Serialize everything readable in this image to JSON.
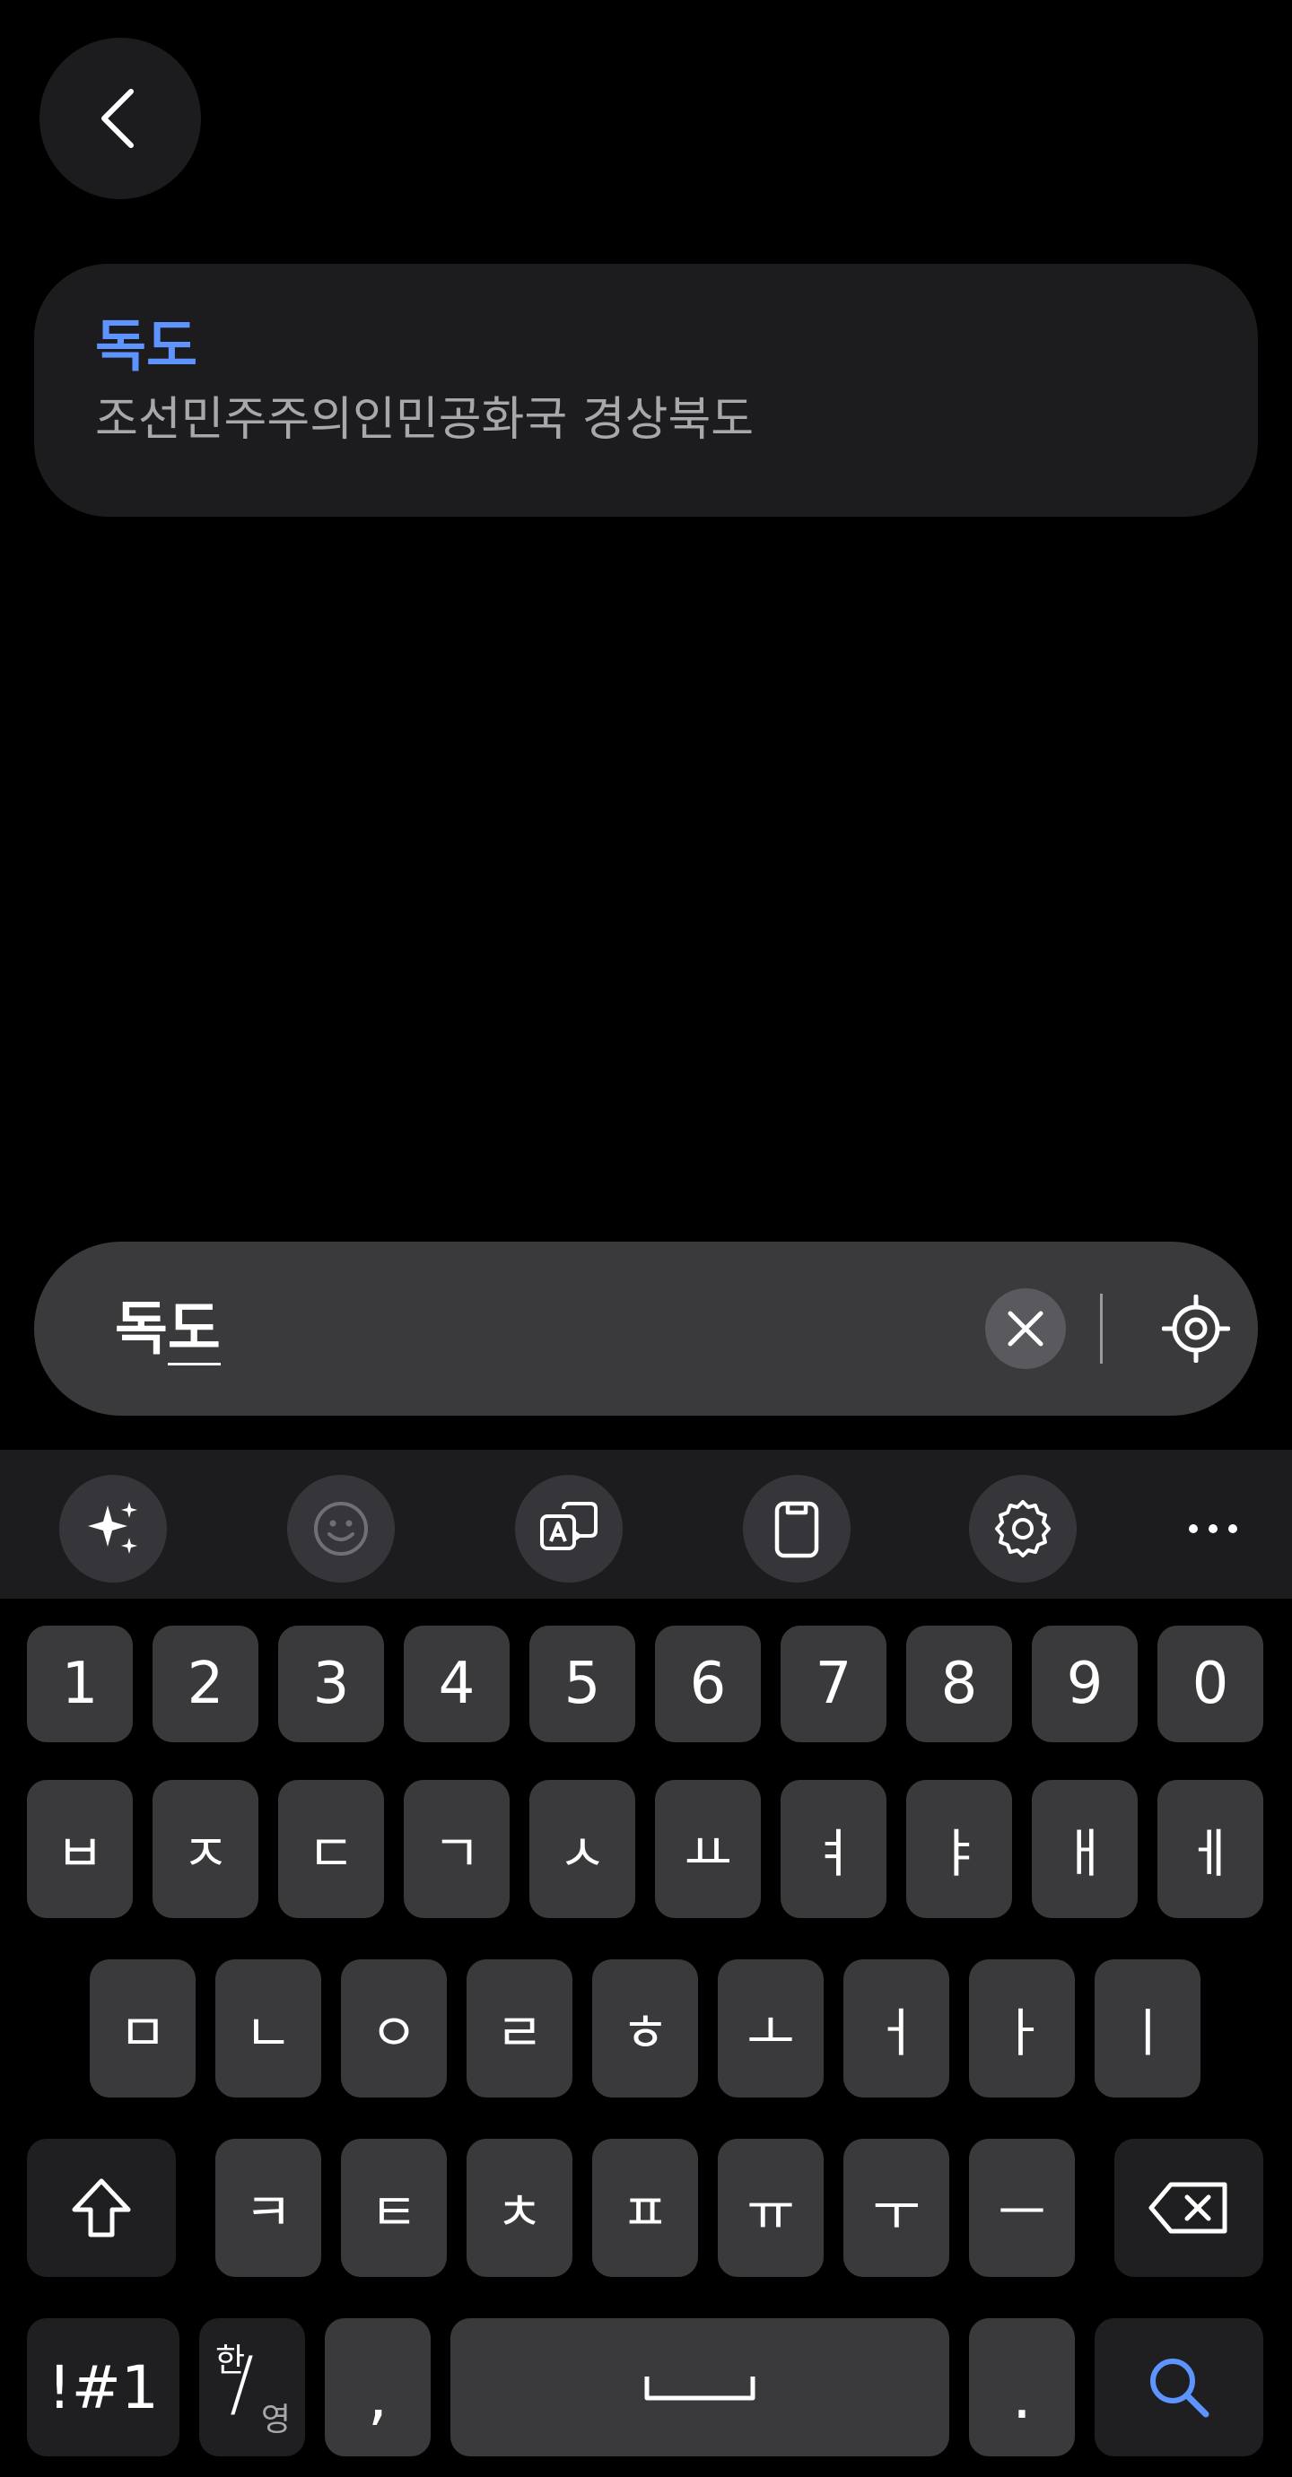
{
  "header": {
    "back_icon": "chevron-left-icon"
  },
  "result": {
    "title": "독도",
    "subtitle": "조선민주주의인민공화국 경상북도"
  },
  "search": {
    "value_committed": "독",
    "value_composing": "도",
    "clear_icon": "close-icon",
    "locate_icon": "crosshair-location-icon"
  },
  "toolbar": {
    "items": [
      "ai-sparkle-icon",
      "emoji-icon",
      "translate-icon",
      "clipboard-icon",
      "settings-gear-icon",
      "more-dots-icon"
    ]
  },
  "keyboard": {
    "row_numbers": [
      "1",
      "2",
      "3",
      "4",
      "5",
      "6",
      "7",
      "8",
      "9",
      "0"
    ],
    "row1": [
      "ㅂ",
      "ㅈ",
      "ㄷ",
      "ㄱ",
      "ㅅ",
      "ㅛ",
      "ㅕ",
      "ㅑ",
      "ㅐ",
      "ㅔ"
    ],
    "row2": [
      "ㅁ",
      "ㄴ",
      "ㅇ",
      "ㄹ",
      "ㅎ",
      "ㅗ",
      "ㅓ",
      "ㅏ",
      "ㅣ"
    ],
    "row3": [
      "ㅋ",
      "ㅌ",
      "ㅊ",
      "ㅍ",
      "ㅠ",
      "ㅜ",
      "ㅡ"
    ],
    "symbols_label": "!#1",
    "lang_han": "한",
    "lang_slash": "/",
    "lang_eng": "영",
    "comma": ",",
    "period": ".",
    "accent_color": "#5e94ff"
  }
}
